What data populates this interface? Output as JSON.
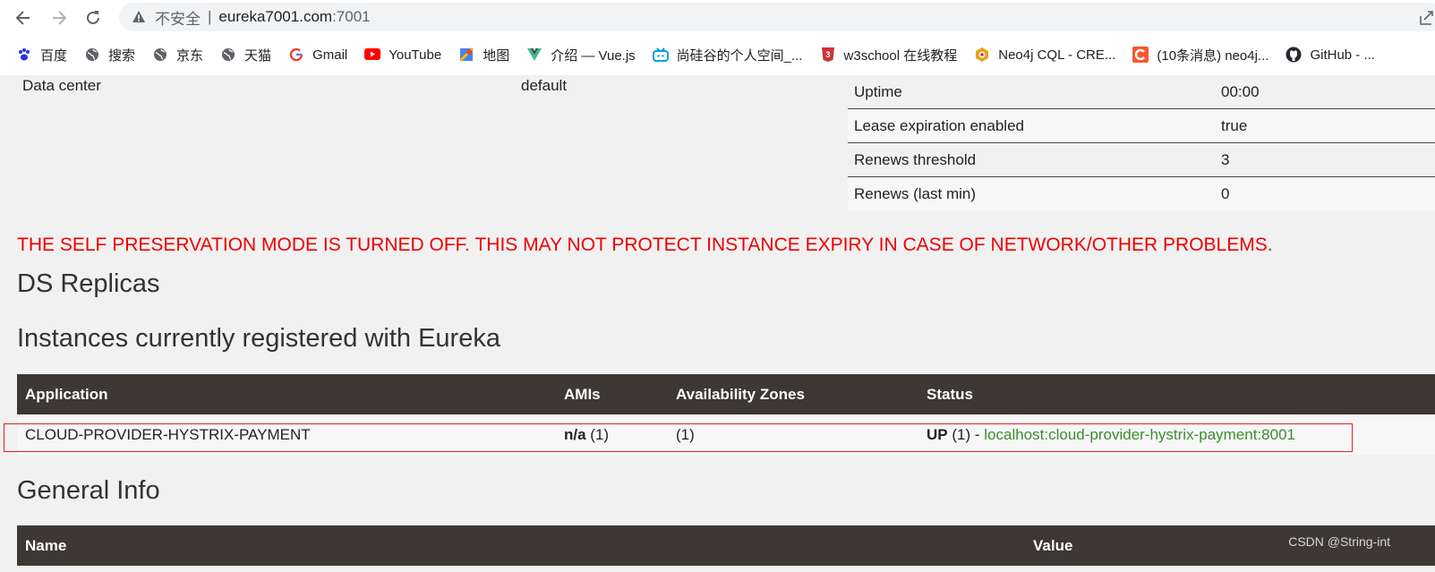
{
  "browser": {
    "address": {
      "security_label": "不安全",
      "separator": "|",
      "host": "eureka7001.com",
      "port": ":7001"
    },
    "bookmarks": [
      {
        "label": "百度",
        "icon": "baidu-paw-icon",
        "color": "#2932e1"
      },
      {
        "label": "搜索",
        "icon": "globe-icon",
        "color": "#5f6368"
      },
      {
        "label": "京东",
        "icon": "globe-icon",
        "color": "#5f6368"
      },
      {
        "label": "天猫",
        "icon": "globe-icon",
        "color": "#5f6368"
      },
      {
        "label": "Gmail",
        "icon": "google-g-icon",
        "color": "#4285f4"
      },
      {
        "label": "YouTube",
        "icon": "youtube-icon",
        "color": "#ff0000"
      },
      {
        "label": "地图",
        "icon": "maps-pin-icon",
        "color": "#34a853"
      },
      {
        "label": "介绍 — Vue.js",
        "icon": "vue-logo-icon",
        "color": "#41b883"
      },
      {
        "label": "尚硅谷的个人空间_...",
        "icon": "bilibili-tv-icon",
        "color": "#00a1d6"
      },
      {
        "label": "w3school 在线教程",
        "icon": "w3school-icon",
        "color": "#cc3333"
      },
      {
        "label": "Neo4j CQL - CRE...",
        "icon": "neo4j-hex-icon",
        "color": "#e8a317"
      },
      {
        "label": "(10条消息) neo4j...",
        "icon": "csdn-c-icon",
        "color": "#fc5531"
      },
      {
        "label": "GitHub - ...",
        "icon": "github-cat-icon",
        "color": "#24292e"
      }
    ]
  },
  "env": {
    "data_center": {
      "label": "Data center",
      "value": "default"
    }
  },
  "status": [
    {
      "label": "Uptime",
      "value": "00:00"
    },
    {
      "label": "Lease expiration enabled",
      "value": "true"
    },
    {
      "label": "Renews threshold",
      "value": "3"
    },
    {
      "label": "Renews (last min)",
      "value": "0"
    }
  ],
  "warning": "THE SELF PRESERVATION MODE IS TURNED OFF. THIS MAY NOT PROTECT INSTANCE EXPIRY IN CASE OF NETWORK/OTHER PROBLEMS.",
  "headings": {
    "replicas": "DS Replicas",
    "instances": "Instances currently registered with Eureka",
    "general": "General Info"
  },
  "instances": {
    "columns": {
      "application": "Application",
      "amis": "AMIs",
      "zones": "Availability Zones",
      "status": "Status"
    },
    "rows": [
      {
        "application": "CLOUD-PROVIDER-HYSTRIX-PAYMENT",
        "amis_bold": "n/a",
        "amis_count": "(1)",
        "zones": "(1)",
        "status_bold": "UP",
        "status_count": "(1) -",
        "instance_link": "localhost:cloud-provider-hystrix-payment:8001"
      }
    ]
  },
  "general": {
    "columns": {
      "name": "Name",
      "value": "Value"
    }
  },
  "watermark": "CSDN @String-int",
  "colors": {
    "warning": "#ee0000",
    "header_bg": "#3d3833",
    "link": "#3c8d2f",
    "highlight_box": "#e02020"
  }
}
